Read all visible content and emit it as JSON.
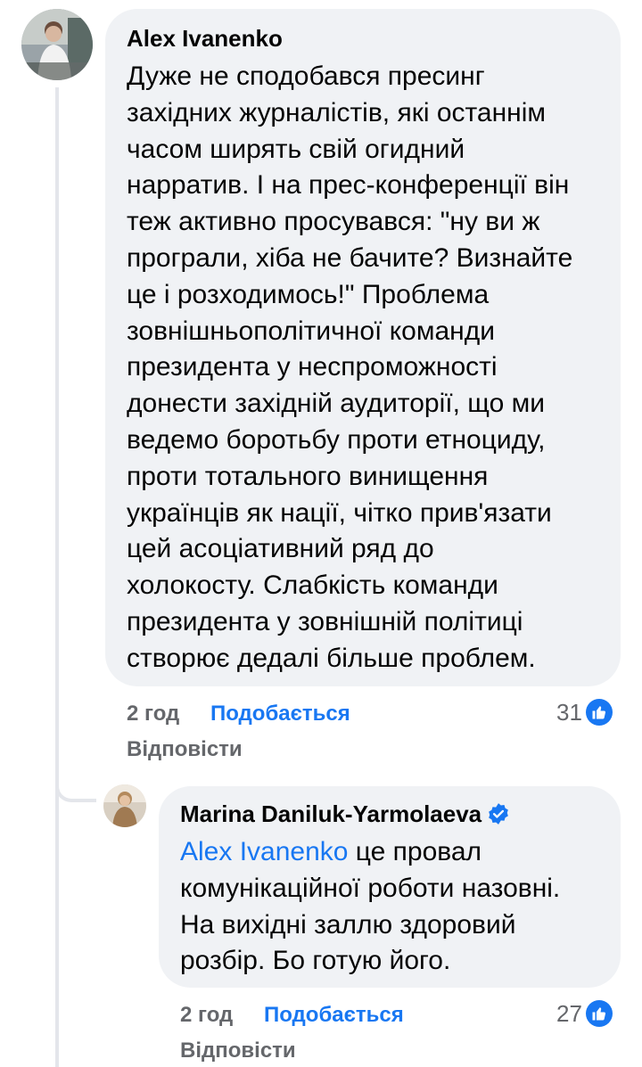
{
  "comments": [
    {
      "author": "Alex Ivanenko",
      "text": "Дуже не сподобався пресинг\nзахідних журналістів, які останнім\nчасом ширять свій огидний\nнарратив. І на прес-конференції він\nтеж активно просувався: \"ну ви ж\nпрограли, хіба не бачите? Визнайте\nце і розходимось!\" Проблема\nзовнішньополітичної команди\nпрезидента у неспроможності\nдонести західній аудиторії, що ми\nведемо боротьбу проти етноциду,\nпроти тотального винищення\nукраїнців як нації, чітко прив'язати\nцей асоціативний ряд до\nхолокосту. Слабкість команди\nпрезидента у зовнішній політиці\nстворює дедалі більше проблем.",
      "time": "2 год",
      "like_label": "Подобається",
      "reply_label": "Відповісти",
      "reaction_count": "31",
      "reaction_icon": "thumbs-up-icon"
    }
  ],
  "reply": {
    "author": "Marina Daniluk-Yarmolaeva",
    "verified_icon": "verified-badge-icon",
    "mention": "Alex Ivanenko",
    "text_first_line": " це провал",
    "text_rest": "комунікаційної роботи назовні.\nНа вихідні заллю здоровий\nрозбір. Бо готую його.",
    "time": "2 год",
    "like_label": "Подобається",
    "reply_label": "Відповісти",
    "reaction_count": "27",
    "reaction_icon": "thumbs-up-icon"
  },
  "colors": {
    "bubble": "#f0f2f5",
    "accent": "#1877f2",
    "muted": "#65676b",
    "text": "#050505"
  }
}
